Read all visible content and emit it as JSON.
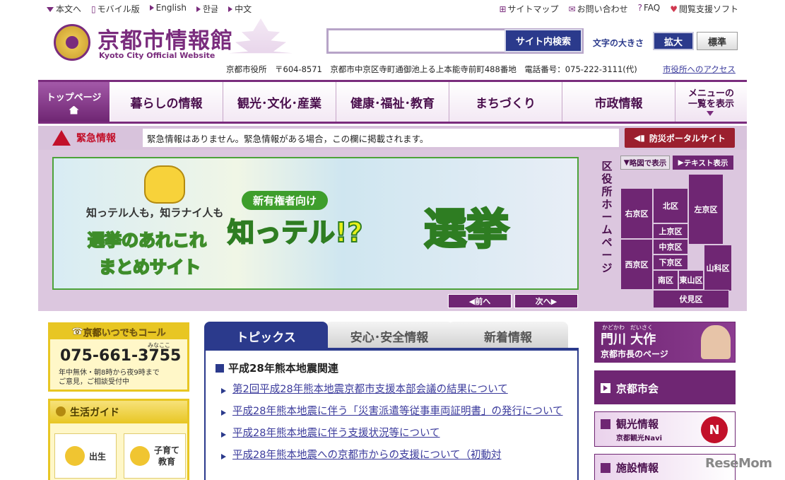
{
  "topbar": {
    "left": [
      "本文へ",
      "モバイル版",
      "English",
      "한글",
      "中文"
    ],
    "right": [
      "サイトマップ",
      "お問い合わせ",
      "FAQ",
      "閲覧支援ソフト"
    ]
  },
  "header": {
    "title": "京都市情報館",
    "subtitle": "Kyoto City Official Website",
    "search_button": "サイト内検索",
    "search_placeholder": "",
    "font_size_label": "文字の大きさ",
    "enlarge": "拡大",
    "standard": "標準",
    "address": "京都市役所　〒604-8571　京都市中京区寺町通御池上る上本能寺前町488番地　電話番号：075-222-3111(代)",
    "access_link": "市役所へのアクセス"
  },
  "nav": {
    "home": "トップページ",
    "items": [
      "暮らしの情報",
      "観光･文化･産業",
      "健康･福祉･教育",
      "まちづくり",
      "市政情報"
    ],
    "menu_line1": "メニューの",
    "menu_line2": "一覧を表示"
  },
  "emergency": {
    "label": "緊急情報",
    "message": "緊急情報はありません。緊急情報がある場合，この欄に掲載されます。",
    "portal": "防災ポータルサイト"
  },
  "banner": {
    "line1": "知っテル人も，知ラナイ人も",
    "line2": "選挙のあれこれ",
    "line3": "まとめサイト",
    "badge": "新有権者向け",
    "catch": "知っテル!?",
    "big": "選挙",
    "prev": "前へ",
    "next": "次へ"
  },
  "wards": {
    "vertical_label": "区役所ホームページ",
    "map_btn": "略図で表示",
    "text_btn": "テキスト表示",
    "names": [
      "右京区",
      "北区",
      "左京区",
      "上京区",
      "中京区",
      "下京区",
      "山科区",
      "西京区",
      "南区",
      "東山区",
      "伏見区"
    ]
  },
  "call": {
    "title": "京都いつでもコール",
    "kana": "みなここ",
    "number": "075-661-3755",
    "note1": "年中無休・朝8時から夜9時まで",
    "note2": "ご意見，ご相談受付中"
  },
  "guide": {
    "title": "生活ガイド",
    "item1": "出生",
    "item2a": "子育て",
    "item2b": "教育"
  },
  "tabs": [
    "トピックス",
    "安心･安全情報",
    "新着情報"
  ],
  "topics": {
    "heading": "平成28年熊本地震関連",
    "items": [
      "第2回平成28年熊本地震京都市支援本部会議の結果について",
      "平成28年熊本地震に伴う「災害派遣等従事車両証明書」の発行について",
      "平成28年熊本地震に伴う支援状況等について",
      "平成28年熊本地震への京都市からの支援について（初動対"
    ]
  },
  "right": {
    "mayor_kana": "かどかわ　だいさく",
    "mayor_name": "門川 大作",
    "mayor_sub": "京都市長のページ",
    "council": "京都市会",
    "tour": "観光情報",
    "tour_sub": "京都観光Navi",
    "facility": "施設情報"
  },
  "watermark": "ReseMom"
}
